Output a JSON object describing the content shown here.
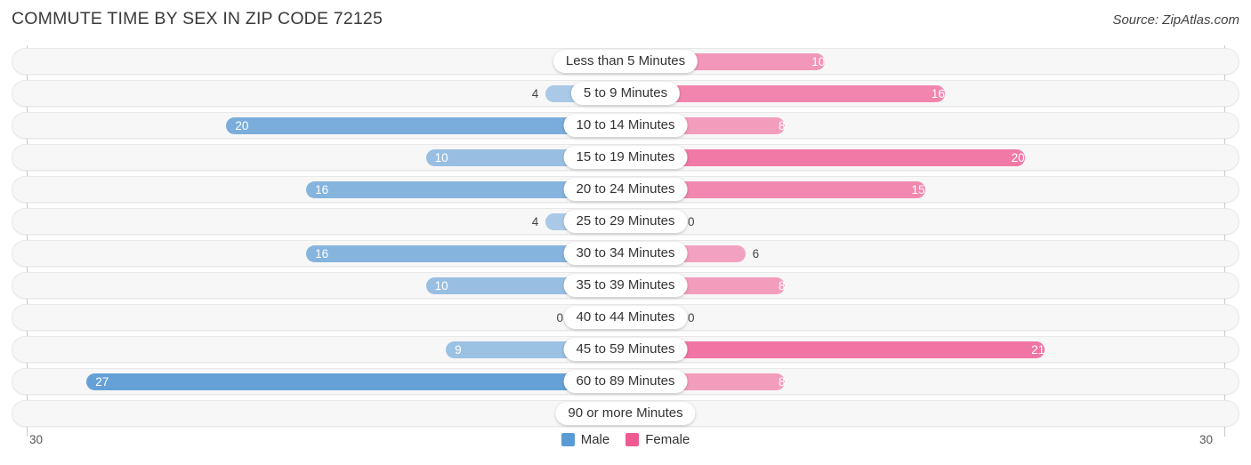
{
  "title": "COMMUTE TIME BY SEX IN ZIP CODE 72125",
  "source": "Source: ZipAtlas.com",
  "axis": {
    "left_label": "30",
    "right_label": "30"
  },
  "legend": [
    {
      "label": "Male",
      "color": "#5b9bd5"
    },
    {
      "label": "Female",
      "color": "#ef5a92"
    }
  ],
  "chart_data": {
    "type": "bar",
    "subtype": "diverging-bar",
    "title": "COMMUTE TIME BY SEX IN ZIP CODE 72125",
    "xlabel": "",
    "ylabel": "",
    "xlim": [
      30,
      30
    ],
    "axis_max": 30,
    "grid": false,
    "legend_position": "bottom-center",
    "categories": [
      "Less than 5 Minutes",
      "5 to 9 Minutes",
      "10 to 14 Minutes",
      "15 to 19 Minutes",
      "20 to 24 Minutes",
      "25 to 29 Minutes",
      "30 to 34 Minutes",
      "35 to 39 Minutes",
      "40 to 44 Minutes",
      "45 to 59 Minutes",
      "60 to 89 Minutes",
      "90 or more Minutes"
    ],
    "series": [
      {
        "name": "Male",
        "color": "#5b9bd5",
        "direction": "left",
        "values": [
          0,
          4,
          20,
          10,
          16,
          4,
          16,
          10,
          0,
          9,
          27,
          0
        ]
      },
      {
        "name": "Female",
        "color": "#ef5a92",
        "direction": "right",
        "values": [
          10,
          16,
          8,
          20,
          15,
          0,
          6,
          8,
          0,
          21,
          8,
          0
        ]
      }
    ]
  }
}
